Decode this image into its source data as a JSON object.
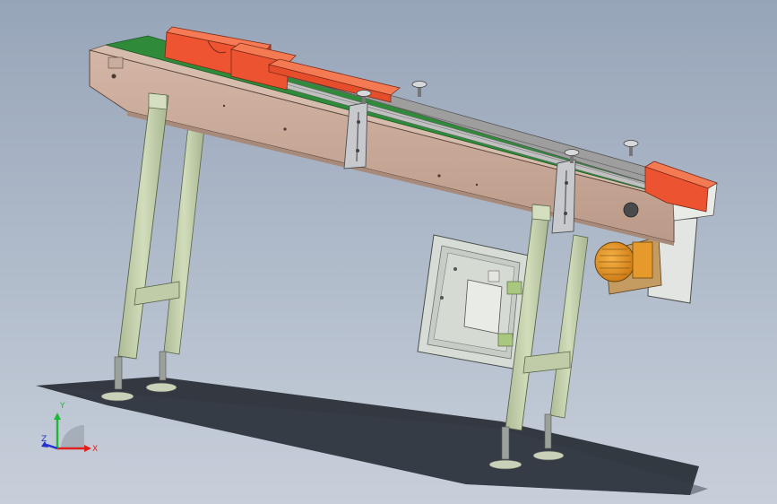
{
  "scene": {
    "subject": "conveyor-3d-model",
    "colors": {
      "background_top": "#9aa8bb",
      "background_bottom": "#c4ccd8",
      "frame": "#c8a796",
      "frame_top": "#dcc2b4",
      "belt": "#2f8a3a",
      "product": "#f05a3a",
      "legs": "#c6d3ae",
      "panel": "#d9ddd7",
      "motor": "#e8921e",
      "guide_rail": "#9a9a9a",
      "shadow": "#2a2f38"
    }
  },
  "axis_triad": {
    "x_label": "X",
    "y_label": "Y",
    "z_label": "Z",
    "x_color": "#e0201c",
    "y_color": "#21b83a",
    "z_color": "#2230d0"
  }
}
